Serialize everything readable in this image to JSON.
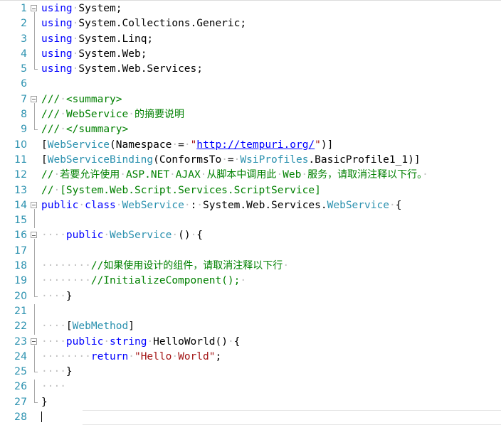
{
  "editor": {
    "name": "code-editor",
    "language": "csharp",
    "background_color": "#ffffff",
    "line_number_color": "#2b91af",
    "keyword_color": "#0000ff",
    "type_color": "#2b91af",
    "comment_color": "#008000",
    "string_color": "#a31515",
    "whitespace_dot_color": "#c0c0c0",
    "current_line": 28,
    "total_lines": 28,
    "first_visible_line": 1
  },
  "lines": [
    {
      "n": "1",
      "fold": "box-open",
      "text": "using System;"
    },
    {
      "n": "2",
      "fold": "bar",
      "text": "using System.Collections.Generic;"
    },
    {
      "n": "3",
      "fold": "bar",
      "text": "using System.Linq;"
    },
    {
      "n": "4",
      "fold": "bar",
      "text": "using System.Web;"
    },
    {
      "n": "5",
      "fold": "bar-end",
      "text": "using System.Web.Services;"
    },
    {
      "n": "6",
      "fold": "none",
      "text": ""
    },
    {
      "n": "7",
      "fold": "box-open",
      "text": "/// <summary>"
    },
    {
      "n": "8",
      "fold": "bar",
      "text": "/// WebService 的摘要说明"
    },
    {
      "n": "9",
      "fold": "bar-end",
      "text": "/// </summary>"
    },
    {
      "n": "10",
      "fold": "none",
      "text": "[WebService(Namespace = \"http://tempuri.org/\")]"
    },
    {
      "n": "11",
      "fold": "none",
      "text": "[WebServiceBinding(ConformsTo = WsiProfiles.BasicProfile1_1)]"
    },
    {
      "n": "12",
      "fold": "none",
      "text": "// 若要允许使用 ASP.NET AJAX 从脚本中调用此 Web 服务，请取消注释以下行。 "
    },
    {
      "n": "13",
      "fold": "none",
      "text": "// [System.Web.Script.Services.ScriptService]"
    },
    {
      "n": "14",
      "fold": "box-open",
      "text": "public class WebService : System.Web.Services.WebService {"
    },
    {
      "n": "15",
      "fold": "bar",
      "text": ""
    },
    {
      "n": "16",
      "fold": "box-open",
      "text": "    public WebService () {"
    },
    {
      "n": "17",
      "fold": "bar",
      "text": ""
    },
    {
      "n": "18",
      "fold": "bar",
      "text": "        //如果使用设计的组件，请取消注释以下行 "
    },
    {
      "n": "19",
      "fold": "bar",
      "text": "        //InitializeComponent(); "
    },
    {
      "n": "20",
      "fold": "bar-end",
      "text": "    }"
    },
    {
      "n": "21",
      "fold": "bar",
      "text": ""
    },
    {
      "n": "22",
      "fold": "bar",
      "text": "    [WebMethod]"
    },
    {
      "n": "23",
      "fold": "box-open",
      "text": "    public string HelloWorld() {"
    },
    {
      "n": "24",
      "fold": "bar",
      "text": "        return \"Hello World\";"
    },
    {
      "n": "25",
      "fold": "bar-end",
      "text": "    }"
    },
    {
      "n": "26",
      "fold": "bar",
      "text": "    "
    },
    {
      "n": "27",
      "fold": "bar-end",
      "text": "}"
    },
    {
      "n": "28",
      "fold": "none",
      "text": ""
    }
  ],
  "tokens": {
    "keywords": [
      "using",
      "public",
      "class",
      "string",
      "return"
    ],
    "types": [
      "WebService",
      "WebServiceBinding",
      "WebMethod",
      "WsiProfiles"
    ],
    "string_literals": [
      "\"http://tempuri.org/\"",
      "\"Hello World\""
    ],
    "url": "http://tempuri.org/",
    "comments": [
      "/// <summary>",
      "/// WebService 的摘要说明",
      "/// </summary>",
      "// 若要允许使用 ASP.NET AJAX 从脚本中调用此 Web 服务，请取消注释以下行。",
      "// [System.Web.Script.Services.ScriptService]",
      "//如果使用设计的组件，请取消注释以下行",
      "//InitializeComponent();"
    ]
  }
}
